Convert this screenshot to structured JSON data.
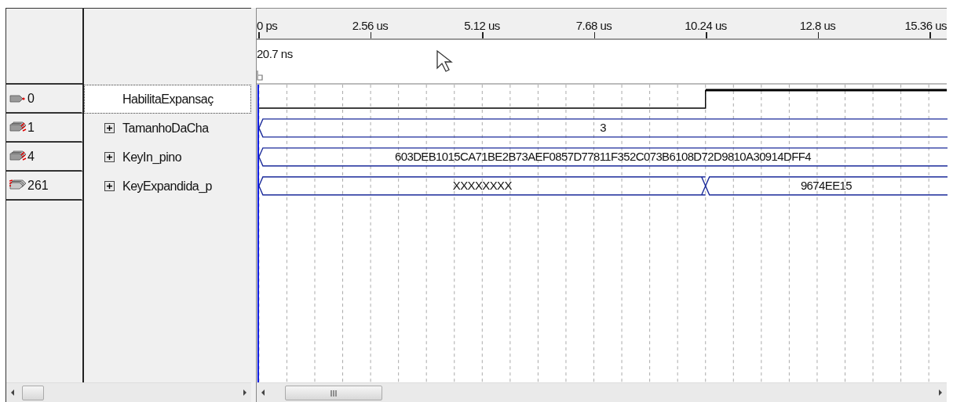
{
  "ruler": {
    "ticks": [
      "0 ps",
      "2.56 us",
      "5.12 us",
      "7.68 us",
      "10.24 us",
      "12.8 us",
      "15.36 us"
    ]
  },
  "cursor": {
    "time": "20.7 ns"
  },
  "signals": [
    {
      "kind": "input",
      "value": "0",
      "name": "HabilitaExpansaç",
      "expandable": false,
      "selected": true
    },
    {
      "kind": "input-bus",
      "value": "1",
      "name": "TamanhoDaCha",
      "expandable": true,
      "selected": false,
      "bus_values": [
        "3"
      ]
    },
    {
      "kind": "input-bus",
      "value": "4",
      "name": "KeyIn_pino",
      "expandable": true,
      "selected": false,
      "bus_values": [
        "603DEB1015CA71BE2B73AEF0857D77811F352C073B6108D72D9810A30914DFF4"
      ]
    },
    {
      "kind": "output-bus",
      "value": "261",
      "name": "KeyExpandida_p",
      "expandable": true,
      "selected": false,
      "bus_values": [
        "XXXXXXXX",
        "9674EE15"
      ]
    }
  ]
}
